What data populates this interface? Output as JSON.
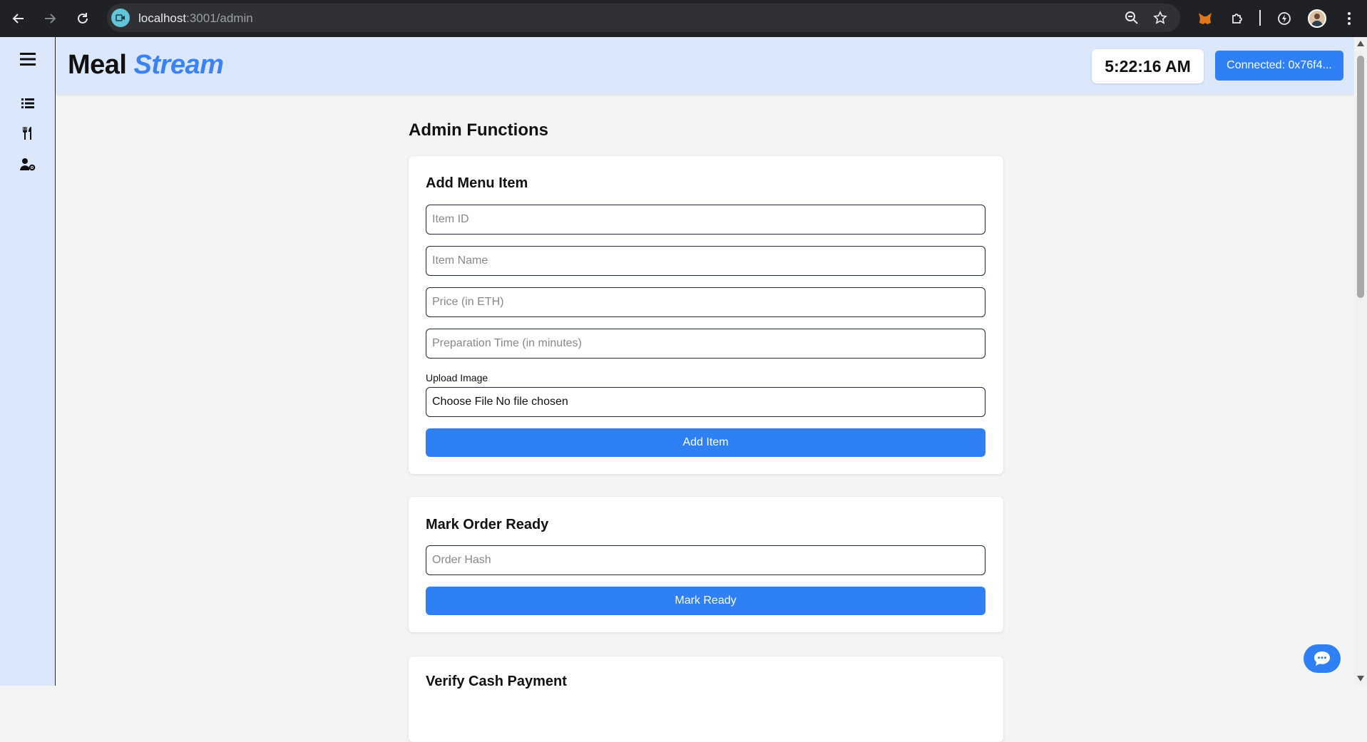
{
  "browser": {
    "url_host": "localhost",
    "url_path": ":3001/admin"
  },
  "header": {
    "brand_part1": "Meal",
    "brand_part2": "Stream",
    "clock": "5:22:16 AM",
    "connect_label": "Connected: 0x76f4..."
  },
  "sidebar": {
    "items": [
      {
        "icon": "hamburger-icon"
      },
      {
        "icon": "list-icon"
      },
      {
        "icon": "utensils-icon"
      },
      {
        "icon": "user-gear-icon"
      }
    ]
  },
  "main": {
    "title": "Admin Functions",
    "add_menu_item": {
      "heading": "Add Menu Item",
      "item_id_placeholder": "Item ID",
      "item_name_placeholder": "Item Name",
      "price_placeholder": "Price (in ETH)",
      "prep_time_placeholder": "Preparation Time (in minutes)",
      "upload_label": "Upload Image",
      "choose_file": "Choose File",
      "no_file": "No file chosen",
      "button": "Add Item"
    },
    "mark_order_ready": {
      "heading": "Mark Order Ready",
      "order_hash_placeholder": "Order Hash",
      "button": "Mark Ready"
    },
    "verify_cash_payment": {
      "heading": "Verify Cash Payment"
    }
  },
  "colors": {
    "accent": "#2f7ff5",
    "sidebar_bg": "#dbe8fb",
    "page_bg": "#f3f4f6"
  }
}
